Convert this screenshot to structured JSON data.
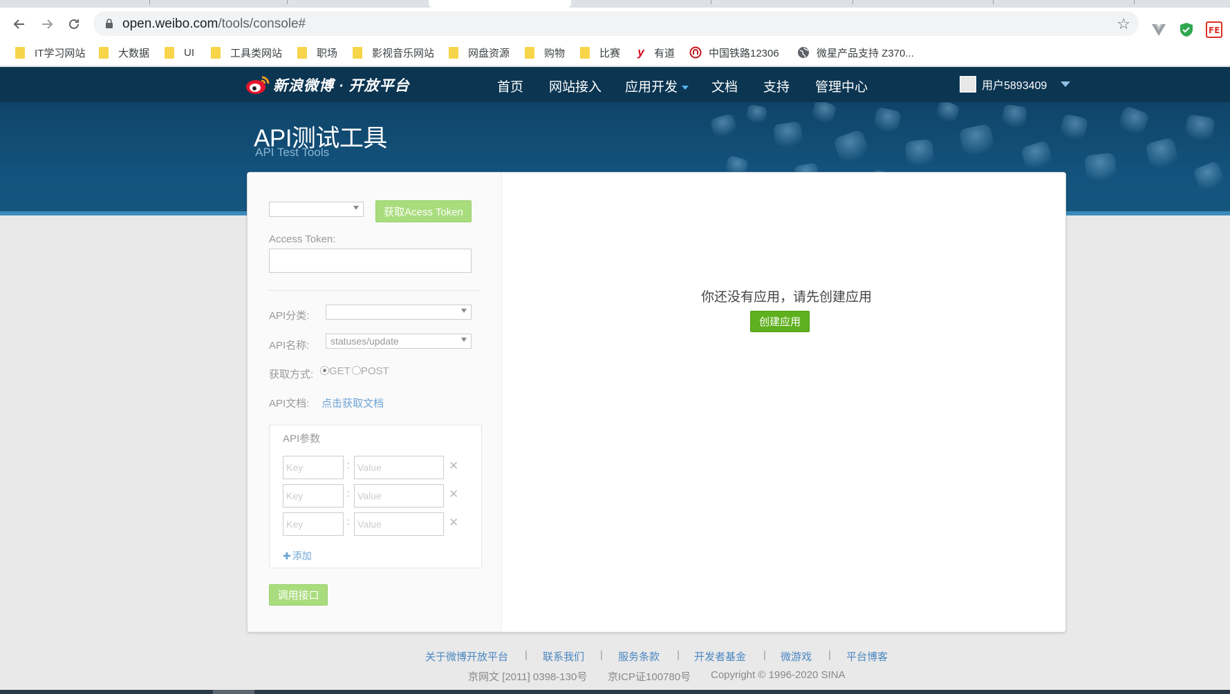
{
  "browser": {
    "url_host": "open.weibo.com",
    "url_path": "/tools/console#",
    "bookmarks": [
      {
        "label": "IT学习网站",
        "icon": "folder-icon"
      },
      {
        "label": "大数据",
        "icon": "folder-icon"
      },
      {
        "label": "UI",
        "icon": "folder-icon"
      },
      {
        "label": "工具类网站",
        "icon": "folder-icon"
      },
      {
        "label": "职场",
        "icon": "folder-icon"
      },
      {
        "label": "影视音乐网站",
        "icon": "folder-icon"
      },
      {
        "label": "网盘资源",
        "icon": "folder-icon"
      },
      {
        "label": "购物",
        "icon": "folder-icon"
      },
      {
        "label": "比赛",
        "icon": "folder-icon"
      },
      {
        "label": "有道",
        "icon": "youdao-icon"
      },
      {
        "label": "中国铁路12306",
        "icon": "railway-icon"
      },
      {
        "label": "微星产品支持 Z370...",
        "icon": "globe-icon"
      }
    ]
  },
  "header": {
    "logo_text": "新浪微博 · 开放平台",
    "nav": [
      "首页",
      "网站接入",
      "应用开发",
      "文档",
      "支持",
      "管理中心"
    ],
    "username": "用户5893409"
  },
  "banner": {
    "title": "API测试工具",
    "subtitle": "API Test Tools"
  },
  "console": {
    "get_token_button": "获取Acess Token",
    "access_token_label": "Access Token:",
    "api_category_label": "API分类:",
    "api_name_label": "API名称:",
    "api_name_value": "statuses/update",
    "method_label": "获取方式:",
    "method_get": "GET",
    "method_post": "POST",
    "doc_label": "API文档:",
    "doc_link": "点击获取文档",
    "params_title": "API参数",
    "key_placeholder": "Key",
    "value_placeholder": "Value",
    "add_label": "添加",
    "call_button": "调用接口",
    "empty_message": "你还没有应用，请先创建应用",
    "create_button": "创建应用"
  },
  "footer": {
    "links": [
      "关于微博开放平台",
      "联系我们",
      "服务条款",
      "开发者基金",
      "微游戏",
      "平台博客"
    ],
    "license1": "京网文 [2011] 0398-130号",
    "license2": "京ICP证100780号",
    "copyright": "Copyright © 1996-2020 SINA"
  },
  "colors": {
    "nav_bg": "#0c3551",
    "banner_bg": "#13527c",
    "accent_green": "#5fb01e",
    "link_blue": "#4a86c1"
  }
}
